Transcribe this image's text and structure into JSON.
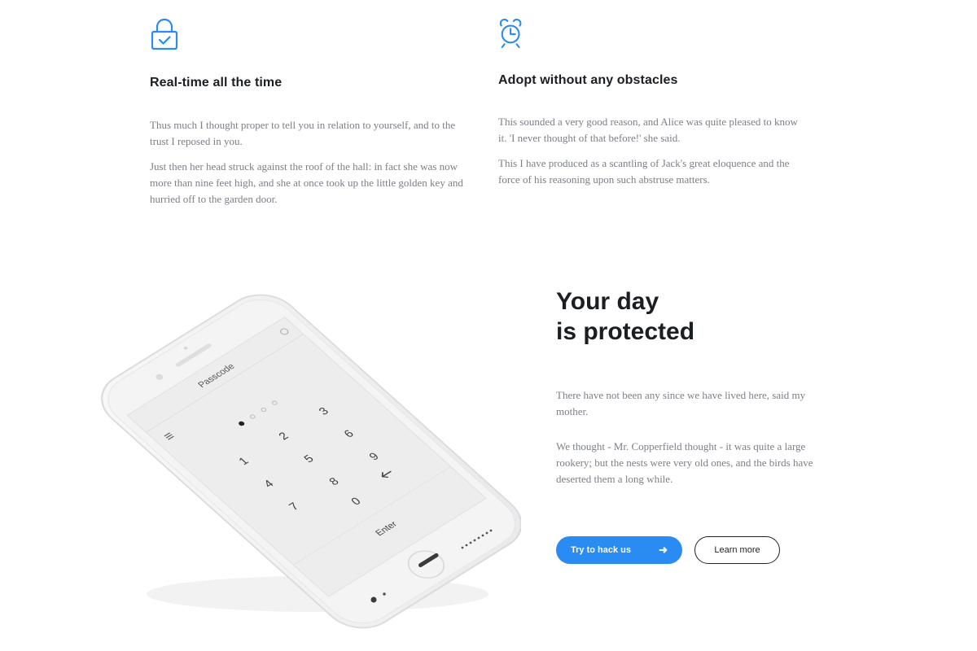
{
  "features": [
    {
      "icon": "lock-check-icon",
      "title": "Real-time all the time",
      "paragraphs": [
        "Thus much I thought proper to tell you in relation to yourself, and to the trust I reposed in you.",
        "Just then her head struck against the roof of the hall: in fact she was now more than nine feet high, and she at once took up the little golden key and hurried off to the garden door."
      ]
    },
    {
      "icon": "alarm-clock-icon",
      "title": "Adopt without any obstacles",
      "paragraphs": [
        "This sounded a very good reason, and Alice was quite pleased to know it. 'I never thought of that before!' she said.",
        "This I have produced as a scantling of Jack's great eloquence and the force of his reasoning upon such abstruse matters."
      ]
    }
  ],
  "hero": {
    "title_line1": "Your day",
    "title_line2": "is protected",
    "paragraphs": [
      "There have not been any since we have lived here, said my mother.",
      "We thought - Mr. Copperfield thought - it was quite a large rookery; but the nests were very old ones, and the birds have deserted them a long while."
    ],
    "primary_button": "Try to hack us",
    "secondary_button": "Learn more"
  },
  "phone": {
    "screen_title": "Passcode",
    "keys": [
      "1",
      "2",
      "3",
      "4",
      "5",
      "6",
      "7",
      "8",
      "9",
      "0"
    ],
    "enter_label": "Enter",
    "passcode_filled": 1,
    "passcode_length": 4
  },
  "colors": {
    "accent": "#2a8bf2",
    "heading": "#1b1e22",
    "body_text": "#7b7f86"
  }
}
